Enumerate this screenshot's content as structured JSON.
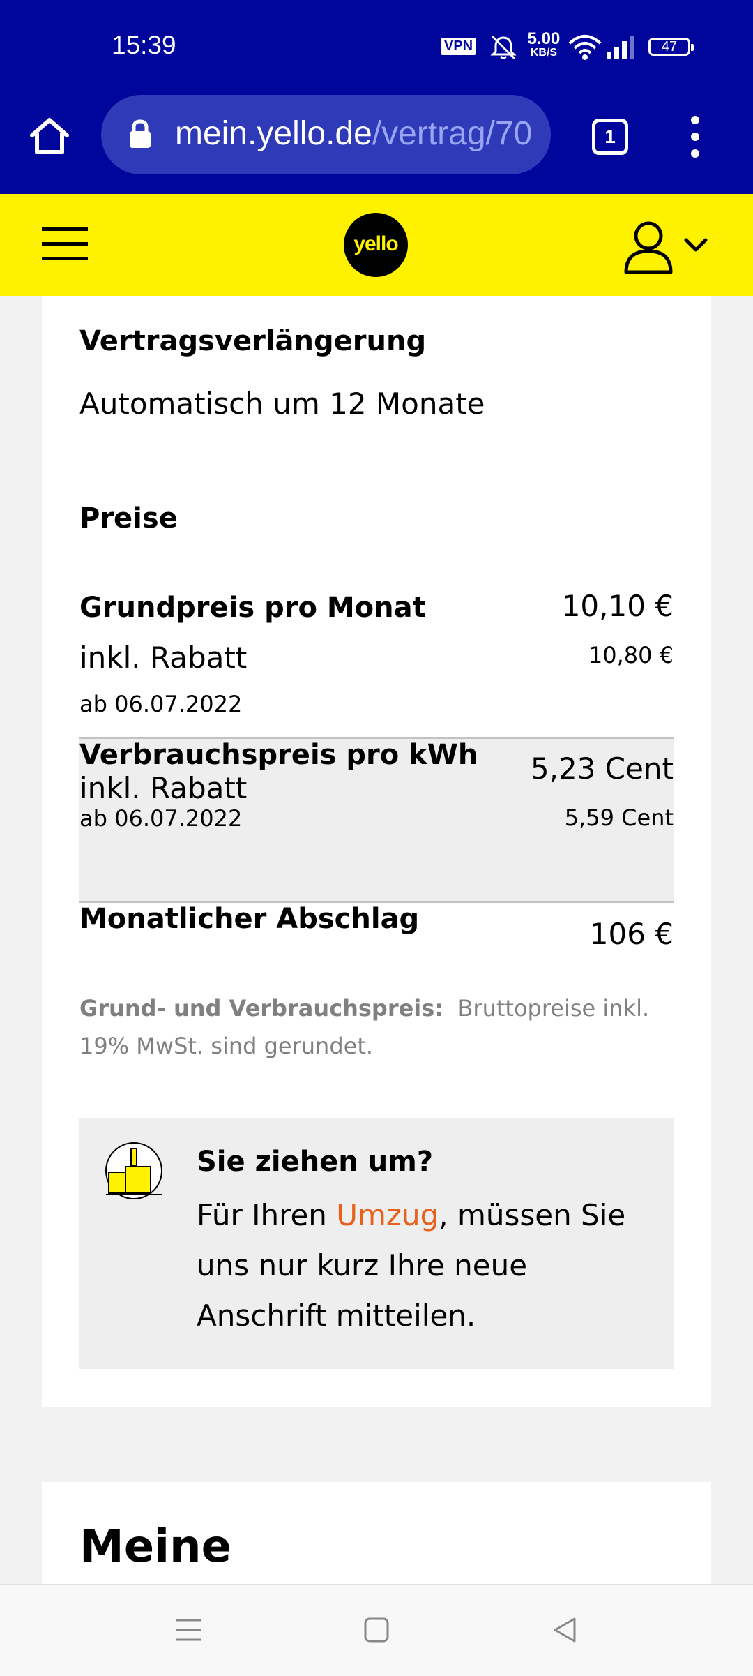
{
  "status_bar": {
    "time": "15:39",
    "vpn_label": "VPN",
    "speed_value": "5.00",
    "speed_unit": "KB/S",
    "battery": "47",
    "icons": [
      "mute-bell-icon",
      "wifi-icon",
      "signal-icon",
      "battery-icon"
    ]
  },
  "browser": {
    "url_domain": "mein.yello.de",
    "url_path": "/vertrag/70",
    "tab_count": "1",
    "icons": [
      "home-icon",
      "lock-icon",
      "more-vert-icon"
    ]
  },
  "header": {
    "logo_text": "yello",
    "icons": [
      "hamburger-icon",
      "user-icon",
      "chevron-down-icon"
    ]
  },
  "contract": {
    "extension_label": "Vertragsverlängerung",
    "extension_value": "Automatisch um 12 Monate",
    "prices_heading": "Preise",
    "base_price": {
      "label": "Grundpreis pro Monat",
      "sub_label": "inkl. Rabatt",
      "date": "ab 06.07.2022",
      "value": "10,10 €",
      "original_value": "10,80 €"
    },
    "consumption_price": {
      "label": "Verbrauchspreis pro kWh",
      "sub_label": "inkl. Rabatt",
      "date": "ab 06.07.2022",
      "value": "5,23 Cent",
      "original_value": "5,59 Cent"
    },
    "monthly_payment": {
      "label": "Monatlicher Abschlag",
      "value": "106 €"
    },
    "note_bold": "Grund- und Verbrauchspreis:",
    "note_text": "Bruttopreise inkl. 19% MwSt. sind gerundet."
  },
  "move_box": {
    "title": "Sie ziehen um?",
    "text_before": "Für Ihren ",
    "link": "Umzug",
    "text_after": ", müssen Sie uns nur kurz Ihre neue Anschrift mitteilen.",
    "icon": "moving-box-lamp-icon"
  },
  "next_section": {
    "heading": "Meine"
  },
  "colors": {
    "browser_bg": "#00069c",
    "brand_yellow": "#fff200",
    "link_orange": "#e8601c"
  }
}
